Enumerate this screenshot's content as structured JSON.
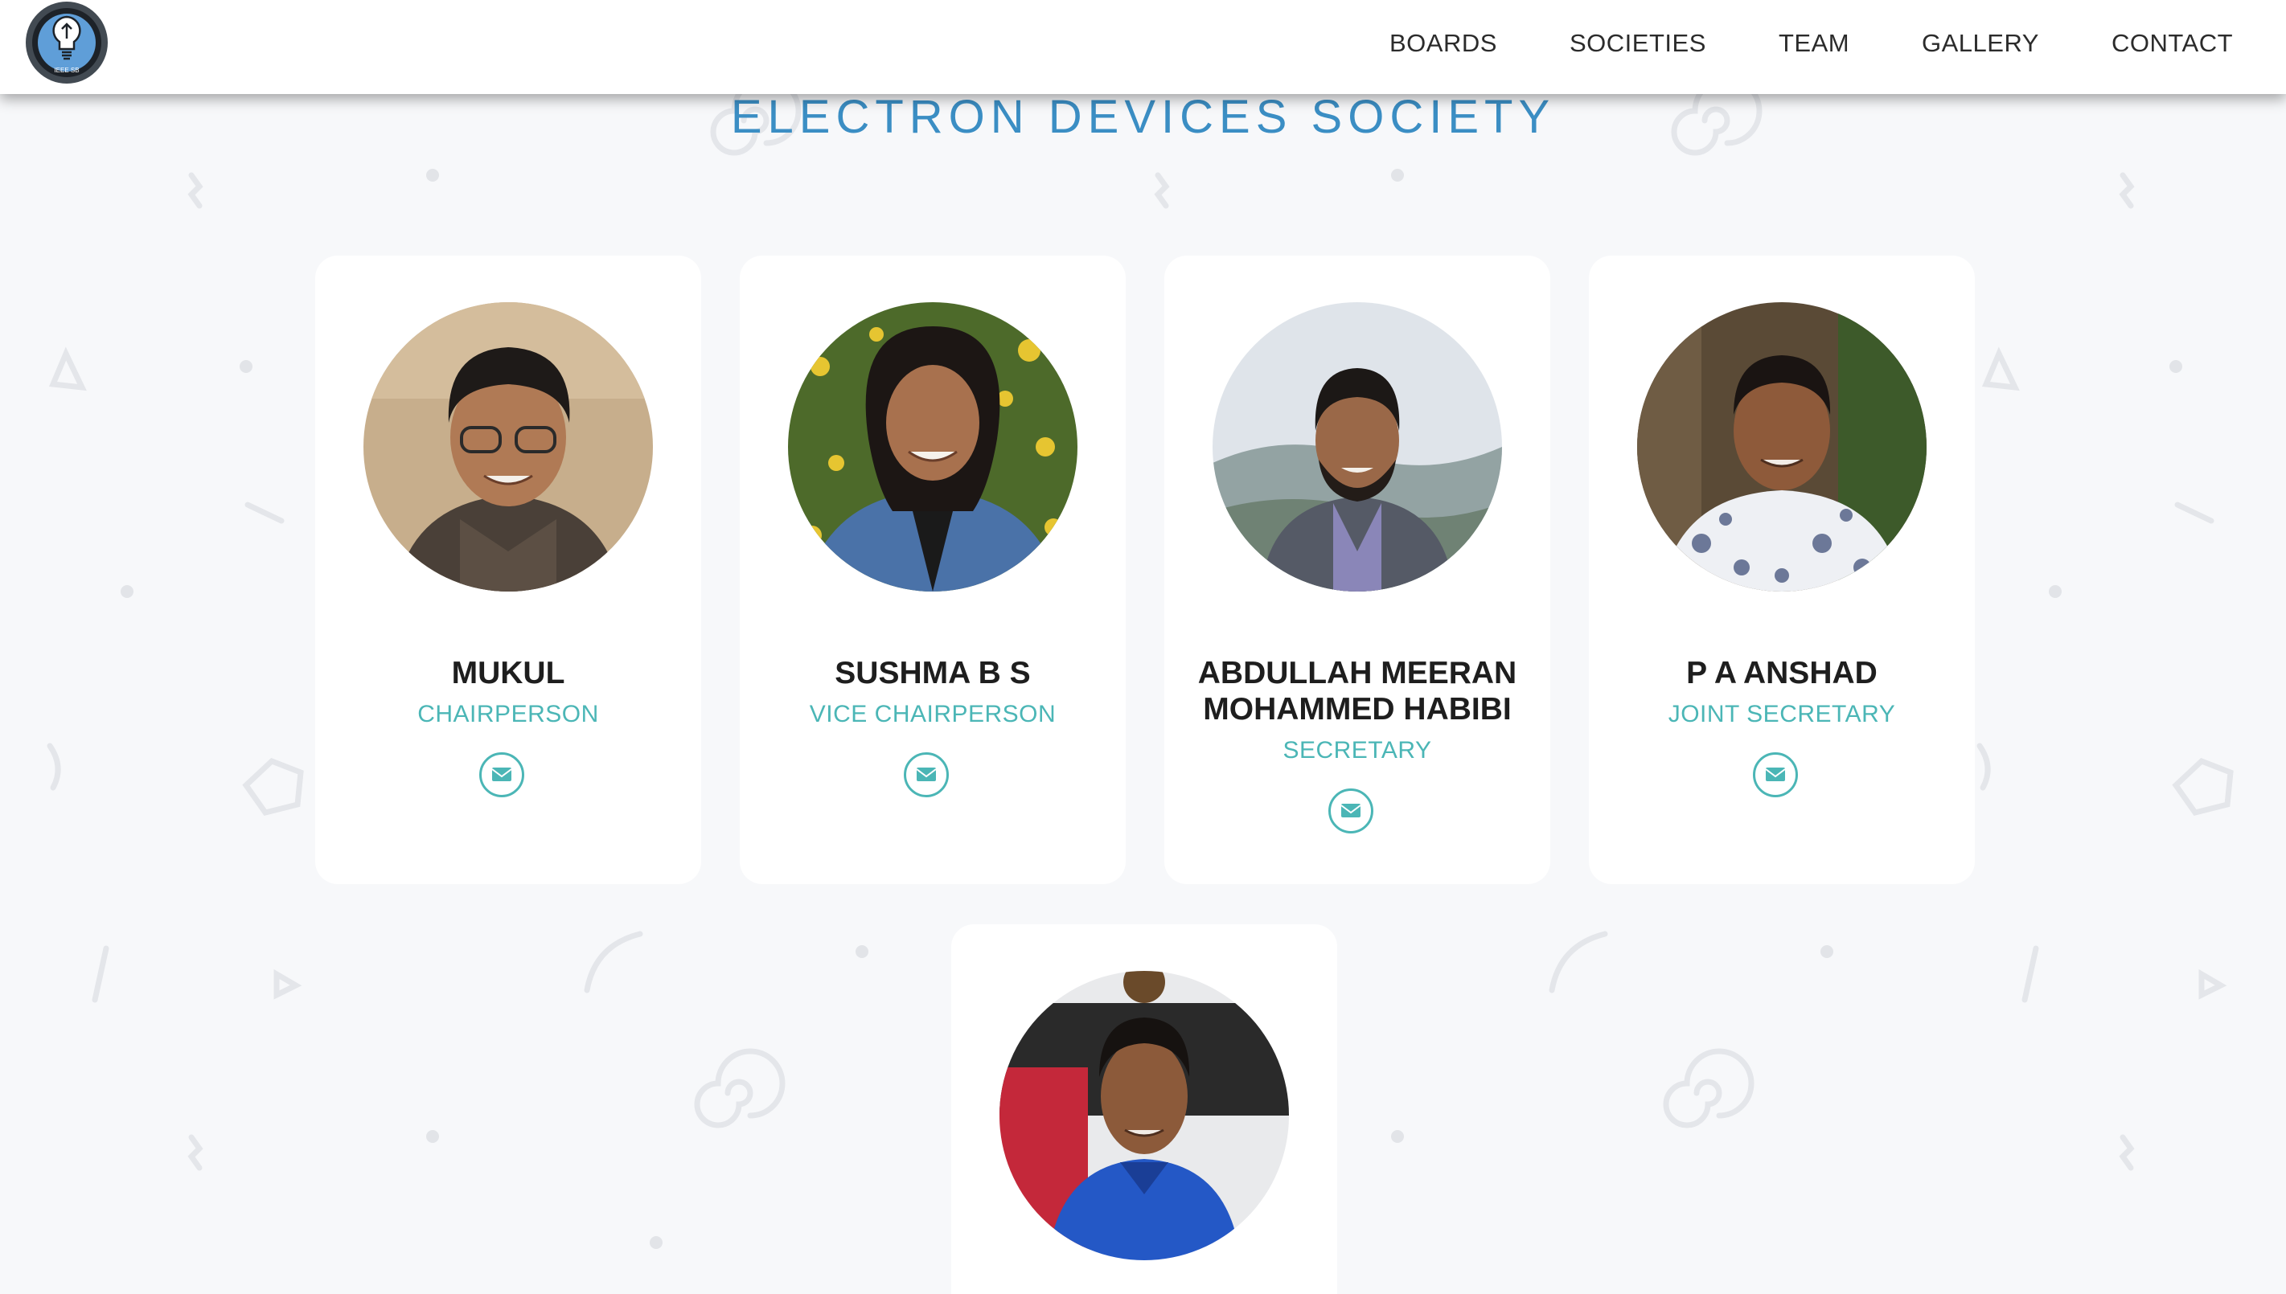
{
  "site": {
    "logo_icon": "lightbulb-logo-icon",
    "logo_caption": "IEEE SB"
  },
  "nav": {
    "items": [
      {
        "label": "BOARDS"
      },
      {
        "label": "SOCIETIES"
      },
      {
        "label": "TEAM"
      },
      {
        "label": "GALLERY"
      },
      {
        "label": "CONTACT"
      }
    ]
  },
  "page": {
    "title": "ELECTRON DEVICES SOCIETY"
  },
  "members": [
    {
      "name": "MUKUL",
      "role": "CHAIRPERSON",
      "icon": "envelope-icon"
    },
    {
      "name": "SUSHMA B S",
      "role": "VICE CHAIRPERSON",
      "icon": "envelope-icon"
    },
    {
      "name": "ABDULLAH MEERAN MOHAMMED HABIBI",
      "role": "SECRETARY",
      "icon": "envelope-icon"
    },
    {
      "name": "P A ANSHAD",
      "role": "JOINT SECRETARY",
      "icon": "envelope-icon"
    },
    {
      "name": "",
      "role": "",
      "icon": "envelope-icon"
    }
  ],
  "colors": {
    "heading": "#3b8ec4",
    "accent": "#4bb6b6",
    "text": "#1e1e1e",
    "page_bg": "#f7f8fa"
  }
}
